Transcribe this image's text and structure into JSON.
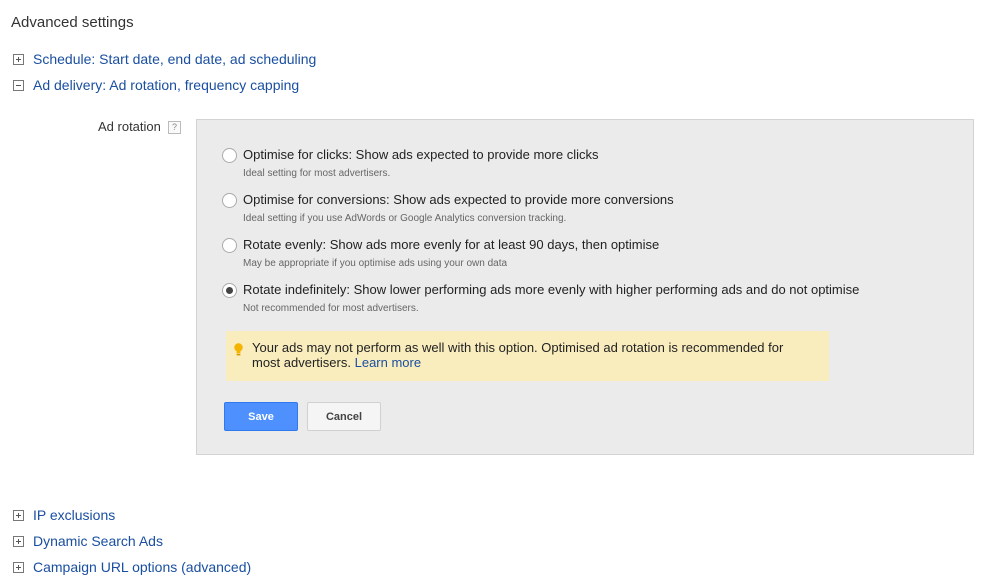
{
  "page_title": "Advanced settings",
  "sections": {
    "schedule": "Schedule: Start date, end date, ad scheduling",
    "ad_delivery": "Ad delivery: Ad rotation, frequency capping",
    "ip_exclusions": "IP exclusions",
    "dynamic_search_ads": "Dynamic Search Ads",
    "campaign_url_options": "Campaign URL options (advanced)"
  },
  "ad_rotation": {
    "label": "Ad rotation",
    "help": "?",
    "options": [
      {
        "label": "Optimise for clicks: Show ads expected to provide more clicks",
        "sub": "Ideal setting for most advertisers.",
        "selected": false
      },
      {
        "label": "Optimise for conversions: Show ads expected to provide more conversions",
        "sub": "Ideal setting if you use AdWords or Google Analytics conversion tracking.",
        "selected": false
      },
      {
        "label": "Rotate evenly: Show ads more evenly for at least 90 days, then optimise",
        "sub": "May be appropriate if you optimise ads using your own data",
        "selected": false
      },
      {
        "label": "Rotate indefinitely: Show lower performing ads more evenly with higher performing ads and do not optimise",
        "sub": "Not recommended for most advertisers.",
        "selected": true
      }
    ],
    "warning": {
      "text": "Your ads may not perform as well with this option. Optimised ad rotation is recommended for most advertisers.",
      "link": "Learn more"
    },
    "save_label": "Save",
    "cancel_label": "Cancel"
  },
  "colors": {
    "link": "#1a4fa0",
    "save_button": "#4d90fe",
    "warning_bg": "#f9edbe",
    "panel_bg": "#ebebeb",
    "bulb": "#f4b400"
  }
}
